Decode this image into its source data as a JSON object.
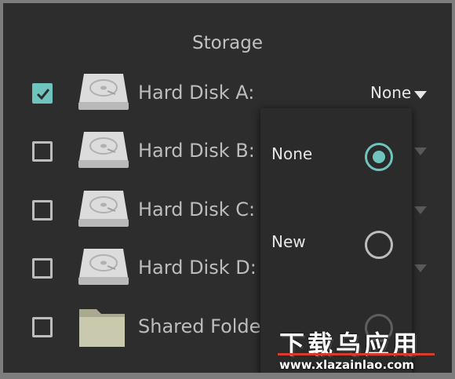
{
  "section_title": "Storage",
  "rows": [
    {
      "label": "Hard Disk A:",
      "checked": true,
      "icon": "hard-disk-icon",
      "selected": "None"
    },
    {
      "label": "Hard Disk B:",
      "checked": false,
      "icon": "hard-disk-icon"
    },
    {
      "label": "Hard Disk C:",
      "checked": false,
      "icon": "hard-disk-icon"
    },
    {
      "label": "Hard Disk D:",
      "checked": false,
      "icon": "hard-disk-icon"
    },
    {
      "label": "Shared Folde",
      "checked": false,
      "icon": "folder-icon"
    }
  ],
  "dropdown": {
    "options": [
      {
        "label": "None",
        "selected": true
      },
      {
        "label": "New",
        "selected": false
      }
    ]
  },
  "watermark": {
    "cn": "下载乌应用",
    "url": "www.xlazainlao.com"
  },
  "colors": {
    "accent": "#6fc5bd",
    "background": "#2d2d2d",
    "text": "#bdbdbd"
  }
}
